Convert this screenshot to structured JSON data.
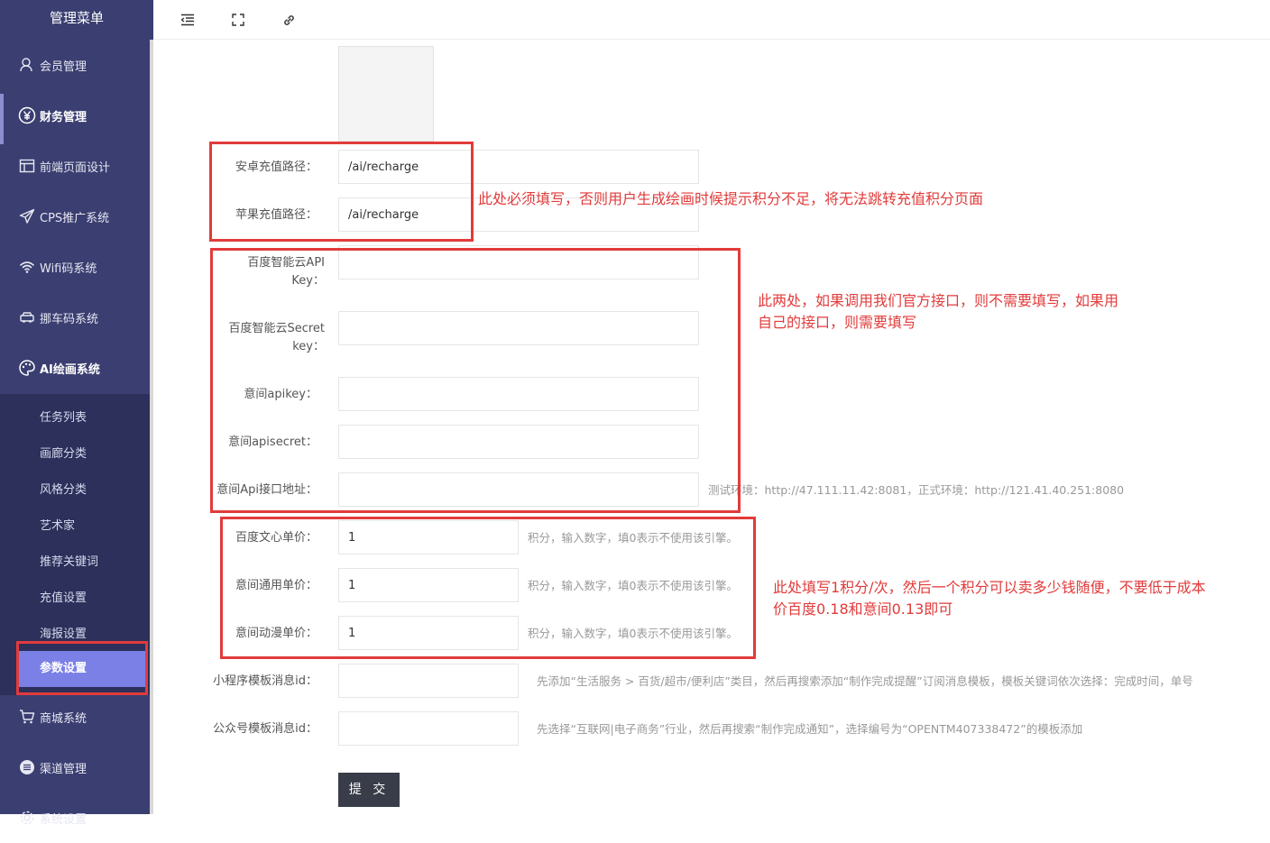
{
  "sidebar": {
    "title": "管理菜单",
    "items": [
      {
        "label": "会员管理",
        "icon": "user-icon"
      },
      {
        "label": "财务管理",
        "icon": "yen-icon"
      },
      {
        "label": "前端页面设计",
        "icon": "layout-icon"
      },
      {
        "label": "CPS推广系统",
        "icon": "send-icon"
      },
      {
        "label": "Wifi码系统",
        "icon": "wifi-icon"
      },
      {
        "label": "挪车码系统",
        "icon": "car-icon"
      },
      {
        "label": "AI绘画系统",
        "icon": "palette-icon"
      },
      {
        "label": "商城系统",
        "icon": "cart-icon"
      },
      {
        "label": "渠道管理",
        "icon": "circle-menu-icon"
      },
      {
        "label": "系统设置",
        "icon": "gear-icon"
      }
    ],
    "subitems": [
      "任务列表",
      "画廊分类",
      "风格分类",
      "艺术家",
      "推荐关键词",
      "充值设置",
      "海报设置",
      "参数设置"
    ]
  },
  "topbar": {
    "icons": [
      "menu-fold-icon",
      "fullscreen-icon",
      "link-icon"
    ]
  },
  "form": {
    "android_label": "安卓充值路径：",
    "android_value": "/ai/recharge",
    "ios_label": "苹果充值路径：",
    "ios_value": "/ai/recharge",
    "baidu_key_label": "百度智能云API Key：",
    "baidu_secret_label": "百度智能云Secret key：",
    "yijian_key_label": "意间apikey：",
    "yijian_secret_label": "意间apisecret：",
    "yijian_url_label": "意间Api接口地址：",
    "yijian_url_hint": "测试环境：http://47.111.11.42:8081，正式环境：http://121.41.40.251:8080",
    "wenxin_price_label": "百度文心单价：",
    "wenxin_price_value": "1",
    "general_price_label": "意间通用单价：",
    "general_price_value": "1",
    "anime_price_label": "意间动漫单价：",
    "anime_price_value": "1",
    "price_hint": "积分，输入数字，填0表示不使用该引擎。",
    "mini_tpl_label": "小程序模板消息id：",
    "mini_tpl_hint": "先添加“生活服务 > 百货/超市/便利店”类目，然后再搜索添加“制作完成提醒”订阅消息模板，模板关键词依次选择：完成时间，单号",
    "mp_tpl_label": "公众号模板消息id：",
    "mp_tpl_hint": "先选择“互联网|电子商务”行业，然后再搜索“制作完成通知”，选择编号为“OPENTM407338472”的模板添加",
    "submit_label": "提 交"
  },
  "annotations": {
    "note1": "此处必须填写，否则用户生成绘画时候提示积分不足，将无法跳转充值积分页面",
    "note2_line1": "此两处，如果调用我们官方接口，则不需要填写，如果用",
    "note2_line2": "自己的接口，则需要填写",
    "note3_line1": "此处填写1积分/次，然后一个积分可以卖多少钱随便，不要低于成本",
    "note3_line2": "价百度0.18和意间0.13即可",
    "color": "#e23b3b"
  }
}
